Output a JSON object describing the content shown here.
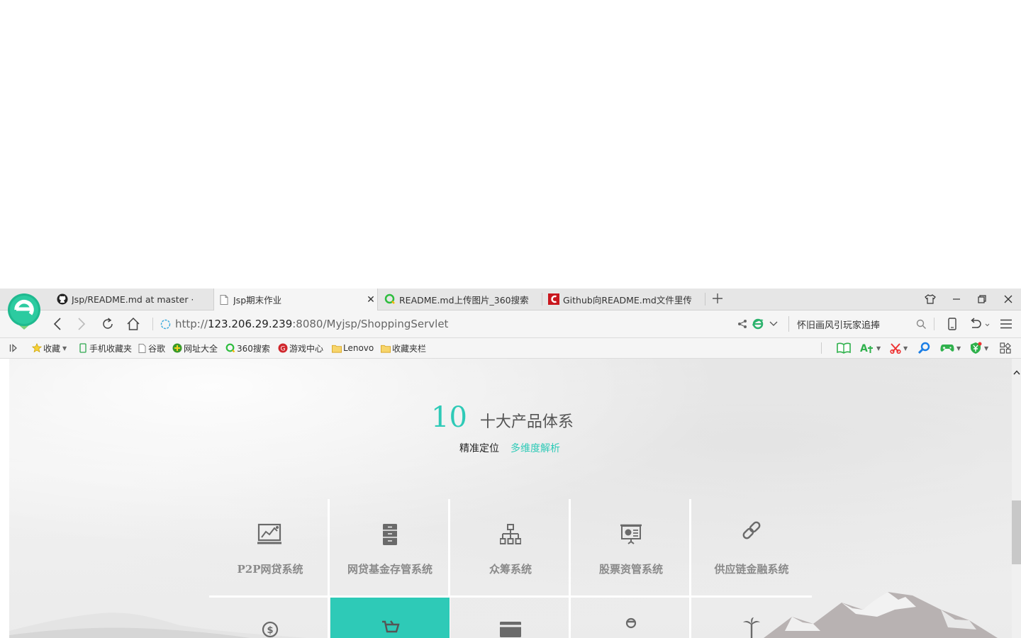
{
  "tabs": [
    {
      "title": "Jsp/README.md at master · ",
      "favicon": "github-icon",
      "active": false
    },
    {
      "title": "Jsp期末作业",
      "favicon": "page-icon",
      "active": true
    },
    {
      "title": "README.md上传图片_360搜索",
      "favicon": "360-search-icon",
      "active": false
    },
    {
      "title": "Github向README.md文件里传",
      "favicon": "csdn-icon",
      "active": false
    }
  ],
  "address": {
    "scheme": "http://",
    "host": "123.206.29.239",
    "rest": ":8080/Myjsp/ShoppingServlet"
  },
  "search": {
    "value": "怀旧画风引玩家追捧"
  },
  "bookmarks": [
    {
      "label": "收藏",
      "icon": "star-icon"
    },
    {
      "label": "手机收藏夹",
      "icon": "phone-icon"
    },
    {
      "label": "谷歌",
      "icon": "page-icon"
    },
    {
      "label": "网址大全",
      "icon": "globe-icon"
    },
    {
      "label": "360搜索",
      "icon": "360-search-icon"
    },
    {
      "label": "游戏中心",
      "icon": "game-center-icon"
    },
    {
      "label": "Lenovo",
      "icon": "folder-icon"
    },
    {
      "label": "收藏夹栏",
      "icon": "folder-icon"
    }
  ],
  "section": {
    "number": "10",
    "title": "十大产品体系",
    "sub_left": "精准定位",
    "sub_right": "多维度解析"
  },
  "products": [
    {
      "label": "P2P网贷系统",
      "icon": "chart-monitor-icon"
    },
    {
      "label": "网贷基金存管系统",
      "icon": "cabinet-icon"
    },
    {
      "label": "众筹系统",
      "icon": "org-chart-icon"
    },
    {
      "label": "股票资管系统",
      "icon": "presentation-icon"
    },
    {
      "label": "供应链金融系统",
      "icon": "link-icon"
    }
  ],
  "colors": {
    "accent": "#2ecab7",
    "tab_bg": "#e6e6e6",
    "bar_bg": "#f5f5f5"
  }
}
